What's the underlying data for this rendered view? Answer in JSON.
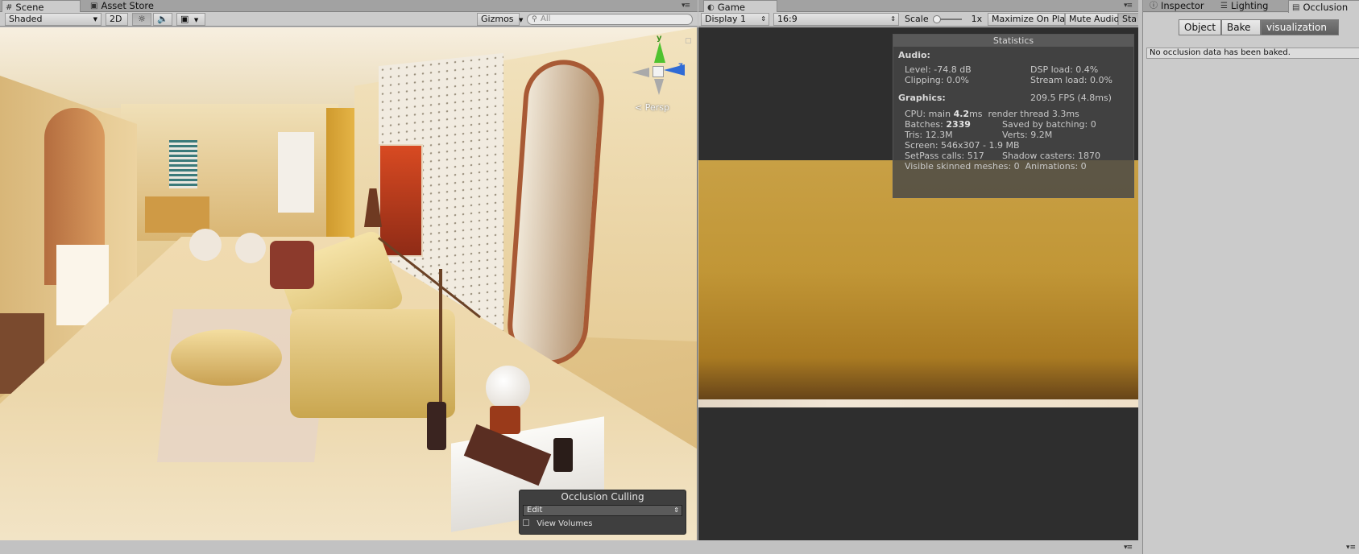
{
  "scene_panel": {
    "tabs": [
      {
        "label": "Scene",
        "icon": "grid-icon"
      },
      {
        "label": "Asset Store",
        "icon": "store-bag-icon"
      }
    ],
    "toolbar": {
      "shading_mode": "Shaded",
      "mode_2d": "2D",
      "gizmos": "Gizmos",
      "search_placeholder": "All"
    },
    "gizmo": {
      "y": "y",
      "z": "z",
      "persp": "Persp"
    },
    "occlusion_overlay": {
      "title": "Occlusion Culling",
      "mode": "Edit",
      "view_volumes": "View Volumes"
    }
  },
  "game_panel": {
    "tab": {
      "label": "Game",
      "icon": "pacman-icon"
    },
    "toolbar": {
      "display": "Display 1",
      "aspect": "16:9",
      "scale_label": "Scale",
      "scale_value": "1x",
      "maximize": "Maximize On Play",
      "mute": "Mute Audio",
      "stats": "Sta"
    },
    "statistics": {
      "title": "Statistics",
      "audio_header": "Audio:",
      "audio_rows": [
        [
          "Level: -74.8 dB",
          "DSP load: 0.4%"
        ],
        [
          "Clipping: 0.0%",
          "Stream load: 0.0%"
        ]
      ],
      "graphics_header": "Graphics:",
      "fps": "209.5 FPS (4.8ms)",
      "cpu": {
        "label": "CPU: main ",
        "main": "4.2",
        "rest": "ms  render thread 3.3ms"
      },
      "batches": {
        "label": "Batches: ",
        "value": "2339",
        "saved": "Saved by batching: 0"
      },
      "tris_row": [
        "Tris: 12.3M",
        "Verts: 9.2M"
      ],
      "screen": "Screen: 546x307 - 1.9 MB",
      "setpass_row": [
        "SetPass calls: 517",
        "Shadow casters: 1870"
      ],
      "skinned": "Visible skinned meshes: 0  Animations: 0"
    }
  },
  "right_panel": {
    "tabs": [
      {
        "label": "Inspector",
        "icon": "info-icon"
      },
      {
        "label": "Lighting",
        "icon": "lighting-icon"
      },
      {
        "label": "Occlusion",
        "icon": "occlusion-icon"
      }
    ],
    "segments": [
      "Object",
      "Bake",
      "visualization"
    ],
    "message": "No occlusion data has been baked."
  },
  "colors": {
    "unity_gray": "#c2c2c2",
    "game_bg": "#2e2e2e",
    "game_wall": "#c59a3b",
    "gizmo_y": "#4fc22f",
    "gizmo_z": "#2f6bd6"
  }
}
